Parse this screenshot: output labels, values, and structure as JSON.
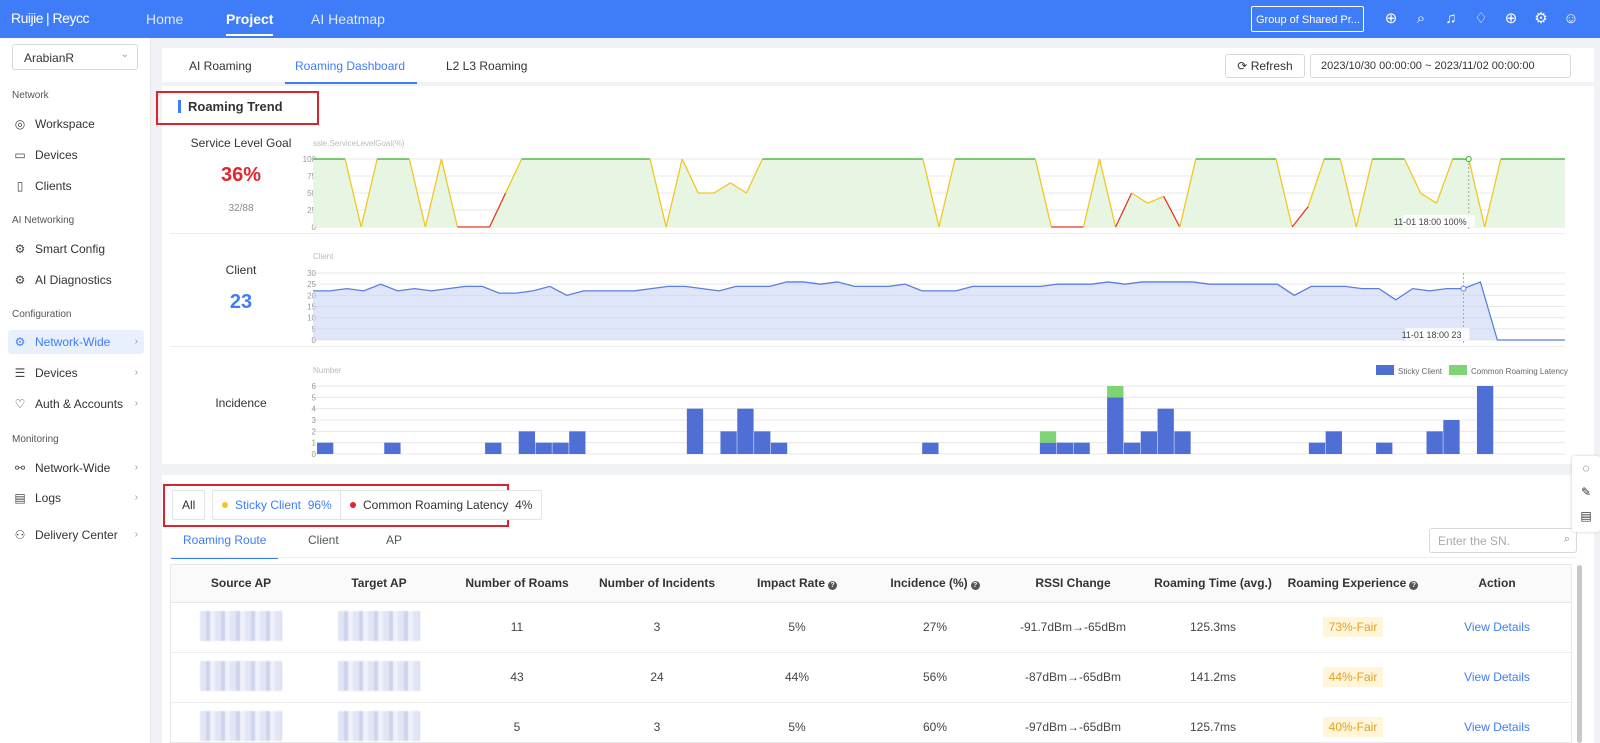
{
  "topbar": {
    "logo": "Ruijie",
    "logo_sub": "| Reycc",
    "nav": [
      "Home",
      "Project",
      "AI Heatmap"
    ],
    "group_select": "Group of Shared Pr...",
    "icons": [
      "add-circle-icon",
      "search-icon",
      "bell-icon",
      "alarm-icon",
      "globe-icon",
      "gear-icon",
      "user-icon"
    ]
  },
  "sidebar": {
    "site": "ArabianR",
    "sections": [
      "Network",
      "AI Networking",
      "Configuration",
      "Monitoring"
    ],
    "items": [
      {
        "label": "Workspace",
        "icon": "workspace-icon"
      },
      {
        "label": "Devices",
        "icon": "devices-icon"
      },
      {
        "label": "Clients",
        "icon": "clients-icon"
      },
      {
        "label": "Smart Config",
        "icon": "smart-config-icon"
      },
      {
        "label": "AI Diagnostics",
        "icon": "ai-diagnostics-icon"
      },
      {
        "label": "Network-Wide",
        "icon": "gear-icon"
      },
      {
        "label": "Devices",
        "icon": "sliders-icon"
      },
      {
        "label": "Auth & Accounts",
        "icon": "auth-icon"
      },
      {
        "label": "Network-Wide",
        "icon": "topology-icon"
      },
      {
        "label": "Logs",
        "icon": "logs-icon"
      },
      {
        "label": "Delivery Center",
        "icon": "delivery-icon"
      }
    ]
  },
  "page_tabs": [
    "AI Roaming",
    "Roaming Dashboard",
    "L2 L3 Roaming"
  ],
  "toolbar": {
    "refresh": "Refresh",
    "date_range": "2023/10/30 00:00:00 ~ 2023/11/02 00:00:00"
  },
  "trend": {
    "title": "Roaming Trend",
    "slg": {
      "label": "Service Level Goal",
      "value": "36%",
      "sub": "32/88",
      "axis_title": "ssle.ServiceLevelGoal(%)",
      "tooltip": "11-01 18:00 100%"
    },
    "client": {
      "label": "Client",
      "value": "23",
      "axis_title": "Client",
      "tooltip": "11-01 18:00 23"
    },
    "incidence": {
      "label": "Incidence",
      "axis_title": "Number",
      "legend": [
        "Sticky Client",
        "Common Roaming Latency"
      ]
    }
  },
  "colors": {
    "accent": "#3f7cf7",
    "good": "#2db11f",
    "warn": "#f2c624",
    "bad": "#e8361e",
    "area_blue": "#5b7ede",
    "sticky": "#4f6fd4",
    "latency": "#7ed374",
    "value_red": "#e4242b",
    "fair": "#e2a220"
  },
  "chart_data": [
    {
      "type": "line",
      "name": "slg",
      "ylim": [
        0,
        100
      ],
      "yticks": [
        "0",
        "25",
        "50",
        "75",
        "100"
      ],
      "values": [
        100,
        100,
        100,
        0,
        100,
        100,
        100,
        0,
        100,
        0,
        0,
        0,
        50,
        100,
        100,
        100,
        100,
        100,
        100,
        100,
        100,
        100,
        0,
        100,
        50,
        50,
        65,
        50,
        100,
        100,
        100,
        100,
        100,
        100,
        100,
        100,
        100,
        100,
        100,
        0,
        100,
        100,
        100,
        100,
        100,
        100,
        0,
        0,
        0,
        100,
        0,
        50,
        35,
        45,
        0,
        100,
        100,
        100,
        100,
        100,
        100,
        0,
        30,
        100,
        100,
        0,
        100,
        100,
        100,
        50,
        35,
        100,
        100,
        0,
        100,
        100,
        100,
        100,
        100
      ]
    },
    {
      "type": "area",
      "name": "client",
      "ylim": [
        0,
        30
      ],
      "yticks": [
        "0",
        "5",
        "10",
        "15",
        "20",
        "25",
        "30"
      ],
      "values": [
        22,
        22,
        23,
        22,
        25,
        22,
        23,
        22,
        23,
        24,
        24,
        21,
        21,
        22,
        24,
        20,
        22,
        22,
        22,
        22,
        23,
        24,
        24,
        23,
        22,
        24,
        24,
        24,
        26,
        26,
        25,
        26,
        24,
        24,
        24,
        25,
        22,
        22,
        22,
        24,
        24,
        24,
        24,
        24,
        25,
        25,
        25,
        26,
        25,
        26,
        26,
        26,
        26,
        25,
        25,
        25,
        25,
        25,
        20,
        24,
        24,
        24,
        23,
        23,
        18,
        23,
        22,
        23,
        23,
        26,
        0,
        0,
        0,
        0,
        0
      ]
    },
    {
      "type": "bar",
      "name": "incidence",
      "ylim": [
        0,
        6
      ],
      "yticks": [
        "0",
        "1",
        "2",
        "3",
        "4",
        "5",
        "6"
      ],
      "series": [
        {
          "name": "Sticky Client",
          "values": [
            1,
            0,
            0,
            0,
            1,
            0,
            0,
            0,
            0,
            0,
            1,
            0,
            2,
            1,
            1,
            2,
            0,
            0,
            0,
            0,
            0,
            0,
            4,
            0,
            2,
            4,
            2,
            1,
            0,
            0,
            0,
            0,
            0,
            0,
            0,
            0,
            1,
            0,
            0,
            0,
            0,
            0,
            0,
            1,
            1,
            1,
            0,
            5,
            1,
            2,
            4,
            2,
            0,
            0,
            0,
            0,
            0,
            0,
            0,
            1,
            2,
            0,
            0,
            1,
            0,
            0,
            2,
            3,
            0,
            6,
            0,
            0,
            0,
            0
          ]
        },
        {
          "name": "Common Roaming Latency",
          "values": [
            0,
            0,
            0,
            0,
            0,
            0,
            0,
            0,
            0,
            0,
            0,
            0,
            0,
            0,
            0,
            0,
            0,
            0,
            0,
            0,
            0,
            0,
            0,
            0,
            0,
            0,
            0,
            0,
            0,
            0,
            0,
            0,
            0,
            0,
            0,
            0,
            0,
            0,
            0,
            0,
            0,
            0,
            0,
            1,
            0,
            0,
            0,
            1,
            0,
            0,
            0,
            0,
            0,
            0,
            0,
            0,
            0,
            0,
            0,
            0,
            0,
            0,
            0,
            0,
            0,
            0,
            0,
            0,
            0,
            0,
            0,
            0,
            0,
            0
          ]
        }
      ]
    }
  ],
  "filters": {
    "all": "All",
    "sticky": "Sticky Client",
    "sticky_pct": "96%",
    "latency": "Common Roaming Latency",
    "latency_pct": "4%"
  },
  "route_tabs": [
    "Roaming Route",
    "Client",
    "AP"
  ],
  "search": {
    "placeholder": "Enter the SN."
  },
  "table": {
    "headers": [
      "Source AP",
      "Target AP",
      "Number of Roams",
      "Number of Incidents",
      "Impact Rate",
      "Incidence (%)",
      "RSSI Change",
      "Roaming Time (avg.)",
      "Roaming Experience",
      "Action"
    ],
    "rows": [
      {
        "roams": "11",
        "incidents": "3",
        "impact": "5%",
        "incidence": "27%",
        "rssi": "-91.7dBm→-65dBm",
        "time": "125.3ms",
        "exp": "73%-Fair",
        "action": "View Details"
      },
      {
        "roams": "43",
        "incidents": "24",
        "impact": "44%",
        "incidence": "56%",
        "rssi": "-87dBm→-65dBm",
        "time": "141.2ms",
        "exp": "44%-Fair",
        "action": "View Details"
      },
      {
        "roams": "5",
        "incidents": "3",
        "impact": "5%",
        "incidence": "60%",
        "rssi": "-97dBm→-65dBm",
        "time": "125.7ms",
        "exp": "40%-Fair",
        "action": "View Details"
      }
    ]
  }
}
